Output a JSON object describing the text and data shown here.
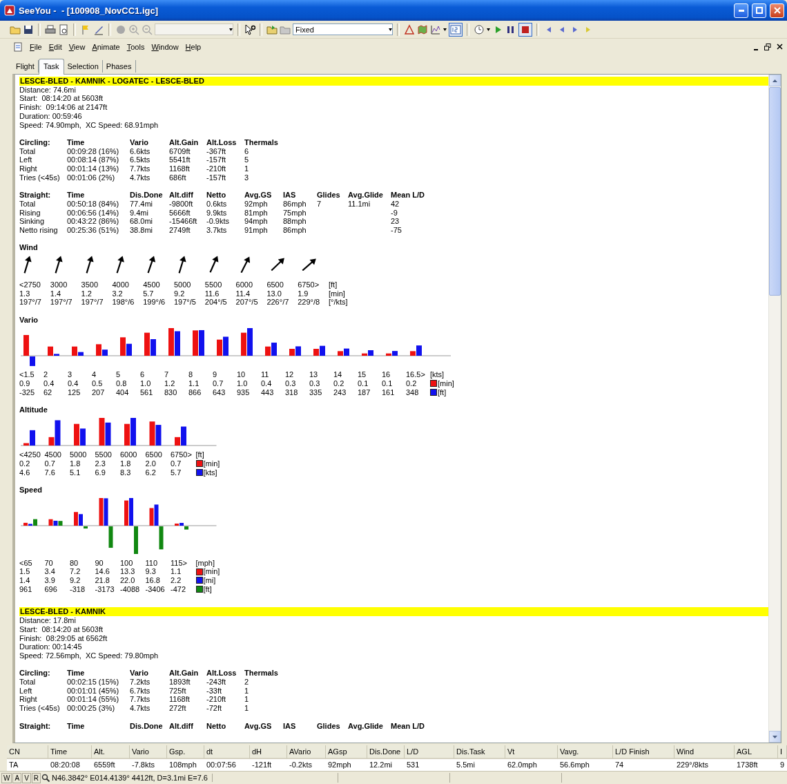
{
  "window": {
    "title": "SeeYou -  - [100908_NovCC1.igc]"
  },
  "toolbar": {
    "scale_combo": "Fixed"
  },
  "menu": [
    "File",
    "Edit",
    "View",
    "Animate",
    "Tools",
    "Window",
    "Help"
  ],
  "tabs": [
    {
      "label": "Flight",
      "selected": false
    },
    {
      "label": "Task",
      "selected": true
    },
    {
      "label": "Selection",
      "selected": false
    },
    {
      "label": "Phases",
      "selected": false
    }
  ],
  "report": {
    "sections": [
      {
        "title": "LESCE-BLED - KAMNIK - LOGATEC - LESCE-BLED",
        "blocks": [
          {
            "kind": "lines",
            "lines": [
              "Distance: 74.6mi",
              "Start:  08:14:20 at 5603ft",
              "Finish:  09:14:06 at 2147ft",
              "Duration: 00:59:46",
              "Speed: 74.90mph,  XC Speed: 68.91mph"
            ]
          },
          {
            "kind": "table",
            "header": [
              "Circling:",
              "Time",
              "Vario",
              "Alt.Gain",
              "Alt.Loss",
              "Thermals"
            ],
            "rows": [
              [
                "Total",
                "00:09:28 (16%)",
                "6.6kts",
                "6709ft",
                "-367ft",
                "6"
              ],
              [
                "Left",
                "00:08:14 (87%)",
                "6.5kts",
                "5541ft",
                "-157ft",
                "5"
              ],
              [
                "Right",
                "00:01:14 (13%)",
                "7.7kts",
                "1168ft",
                "-210ft",
                "1"
              ],
              [
                "Tries (<45s)",
                "00:01:06 (2%)",
                "4.7kts",
                "686ft",
                "-157ft",
                "3"
              ]
            ]
          },
          {
            "kind": "table",
            "header": [
              "Straight:",
              "Time",
              "Dis.Done",
              "Alt.diff",
              "Netto",
              "Avg.GS",
              "IAS",
              "Glides",
              "Avg.Glide",
              "Mean L/D"
            ],
            "rows": [
              [
                "Total",
                "00:50:18 (84%)",
                "77.4mi",
                "-9800ft",
                "0.6kts",
                "92mph",
                "86mph",
                "7",
                "11.1mi",
                "42"
              ],
              [
                "Rising",
                "00:06:56 (14%)",
                "9.4mi",
                "5666ft",
                "9.9kts",
                "81mph",
                "75mph",
                null,
                null,
                "-9"
              ],
              [
                "Sinking",
                "00:43:22 (86%)",
                "68.0mi",
                "-15466ft",
                "-0.9kts",
                "94mph",
                "88mph",
                null,
                null,
                "23"
              ],
              [
                "Netto rising",
                "00:25:36 (51%)",
                "38.8mi",
                "2749ft",
                "3.7kts",
                "91mph",
                "86mph",
                null,
                null,
                "-75"
              ]
            ]
          },
          {
            "kind": "wind",
            "title": "Wind",
            "rows": [
              [
                "<2750",
                "3000",
                "3500",
                "4000",
                "4500",
                "5000",
                "5500",
                "6000",
                "6500",
                "6750>",
                "[ft]"
              ],
              [
                "1.3",
                "1.4",
                "1.2",
                "3.2",
                "5.7",
                "9.2",
                "11.6",
                "11.4",
                "13.0",
                "1.9",
                "[min]"
              ],
              [
                "197°/7",
                "197°/7",
                "197°/7",
                "198°/6",
                "199°/6",
                "197°/5",
                "204°/5",
                "207°/5",
                "226°/7",
                "229°/8",
                "[°/kts]"
              ]
            ]
          },
          {
            "kind": "chart",
            "title": "Vario",
            "rows": [
              {
                "cells": [
                  "<1.5",
                  "2",
                  "3",
                  "4",
                  "5",
                  "6",
                  "7",
                  "8",
                  "9",
                  "10",
                  "11",
                  "12",
                  "13",
                  "14",
                  "15",
                  "16",
                  "16.5>",
                  "[kts]"
                ]
              },
              {
                "cells": [
                  "0.9",
                  "0.4",
                  "0.4",
                  "0.5",
                  "0.8",
                  "1.0",
                  "1.2",
                  "1.1",
                  "0.7",
                  "1.0",
                  "0.4",
                  "0.3",
                  "0.3",
                  "0.2",
                  "0.1",
                  "0.1",
                  "0.2",
                  "[min]"
                ],
                "color": "#ee1111"
              },
              {
                "cells": [
                  "-325",
                  "62",
                  "125",
                  "207",
                  "404",
                  "561",
                  "830",
                  "866",
                  "643",
                  "935",
                  "443",
                  "318",
                  "335",
                  "243",
                  "187",
                  "161",
                  "348",
                  "[ft]"
                ],
                "color": "#1111ee"
              }
            ]
          },
          {
            "kind": "chart",
            "title": "Altitude",
            "rows": [
              {
                "cells": [
                  "<4250",
                  "4500",
                  "5000",
                  "5500",
                  "6000",
                  "6500",
                  "6750>",
                  "[ft]"
                ]
              },
              {
                "cells": [
                  "0.2",
                  "0.7",
                  "1.8",
                  "2.3",
                  "1.8",
                  "2.0",
                  "0.7",
                  "[min]"
                ],
                "color": "#ee1111"
              },
              {
                "cells": [
                  "4.6",
                  "7.6",
                  "5.1",
                  "6.9",
                  "8.3",
                  "6.2",
                  "5.7",
                  "[kts]"
                ],
                "color": "#1111ee"
              }
            ]
          },
          {
            "kind": "chart",
            "title": "Speed",
            "rows": [
              {
                "cells": [
                  "<65",
                  "70",
                  "80",
                  "90",
                  "100",
                  "110",
                  "115>",
                  "[mph]"
                ]
              },
              {
                "cells": [
                  "1.5",
                  "3.4",
                  "7.2",
                  "14.6",
                  "13.3",
                  "9.3",
                  "1.1",
                  "[min]"
                ],
                "color": "#ee1111"
              },
              {
                "cells": [
                  "1.4",
                  "3.9",
                  "9.2",
                  "21.8",
                  "22.0",
                  "16.8",
                  "2.2",
                  "[mi]"
                ],
                "color": "#1111ee"
              },
              {
                "cells": [
                  "961",
                  "696",
                  "-318",
                  "-3173",
                  "-4088",
                  "-3406",
                  "-472",
                  "[ft]"
                ],
                "color": "#118811"
              }
            ]
          }
        ]
      },
      {
        "title": "LESCE-BLED - KAMNIK",
        "blocks": [
          {
            "kind": "lines",
            "lines": [
              "Distance: 17.8mi",
              "Start:  08:14:20 at 5603ft",
              "Finish:  08:29:05 at 6562ft",
              "Duration: 00:14:45",
              "Speed: 72.56mph,  XC Speed: 79.80mph"
            ]
          },
          {
            "kind": "table",
            "header": [
              "Circling:",
              "Time",
              "Vario",
              "Alt.Gain",
              "Alt.Loss",
              "Thermals"
            ],
            "rows": [
              [
                "Total",
                "00:02:15 (15%)",
                "7.2kts",
                "1893ft",
                "-243ft",
                "2"
              ],
              [
                "Left",
                "00:01:01 (45%)",
                "6.7kts",
                "725ft",
                "-33ft",
                "1"
              ],
              [
                "Right",
                "00:01:14 (55%)",
                "7.7kts",
                "1168ft",
                "-210ft",
                "1"
              ],
              [
                "Tries (<45s)",
                "00:00:25 (3%)",
                "4.7kts",
                "272ft",
                "-72ft",
                "1"
              ]
            ]
          },
          {
            "kind": "table",
            "header": [
              "Straight:",
              "Time",
              "Dis.Done",
              "Alt.diff",
              "Netto",
              "Avg.GS",
              "IAS",
              "Glides",
              "Avg.Glide",
              "Mean L/D"
            ]
          }
        ]
      }
    ]
  },
  "grid": {
    "columns": [
      "CN",
      "Time",
      "Alt.",
      "Vario",
      "Gsp.",
      "dt",
      "dH",
      "AVario",
      "AGsp",
      "Dis.Done",
      "L/D",
      "Dis.Task",
      "Vt",
      "Vavg.",
      "L/D Finish",
      "Wind",
      "AGL",
      "I"
    ],
    "rows": [
      [
        "TA",
        "08:20:08",
        "6559ft",
        "-7.8kts",
        "108mph",
        "00:07:56",
        "-121ft",
        "-0.2kts",
        "92mph",
        "12.2mi",
        "531",
        "5.5mi",
        "62.0mph",
        "56.6mph",
        "74",
        "229°/8kts",
        "1738ft",
        "9"
      ]
    ]
  },
  "status_bar": {
    "buttons": [
      "W",
      "A",
      "V",
      "R"
    ],
    "text": "N46.3842° E014.4139° 4412ft, D=3.1mi E=7.6"
  }
}
